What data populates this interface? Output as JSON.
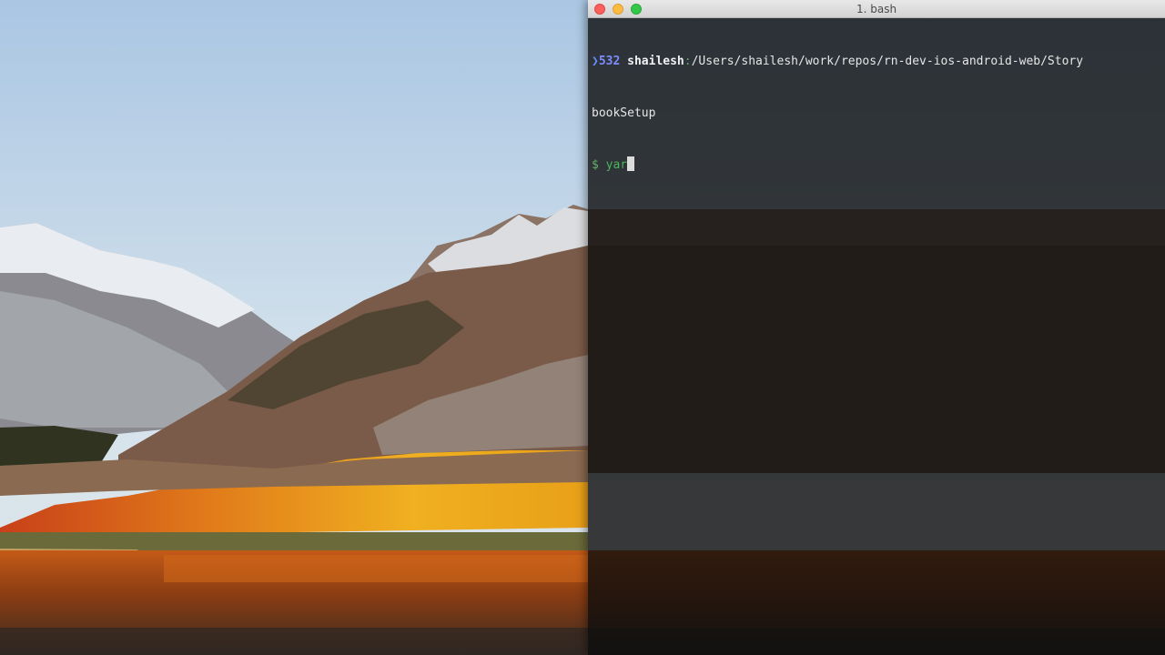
{
  "terminal": {
    "window_title": "1. bash",
    "prompt_marker": "❯",
    "command_number": "532",
    "username": "shailesh",
    "path_separator": ":",
    "cwd_line1": "/Users/shailesh/work/repos/rn-dev-ios-android-web/Story",
    "cwd_line2": "bookSetup",
    "prompt_symbol": "$",
    "typed_command": "yar"
  },
  "colors": {
    "close": "#fc605c",
    "minimize": "#fdbc40",
    "maximize": "#34c84a",
    "prompt_green": "#46b85a"
  }
}
